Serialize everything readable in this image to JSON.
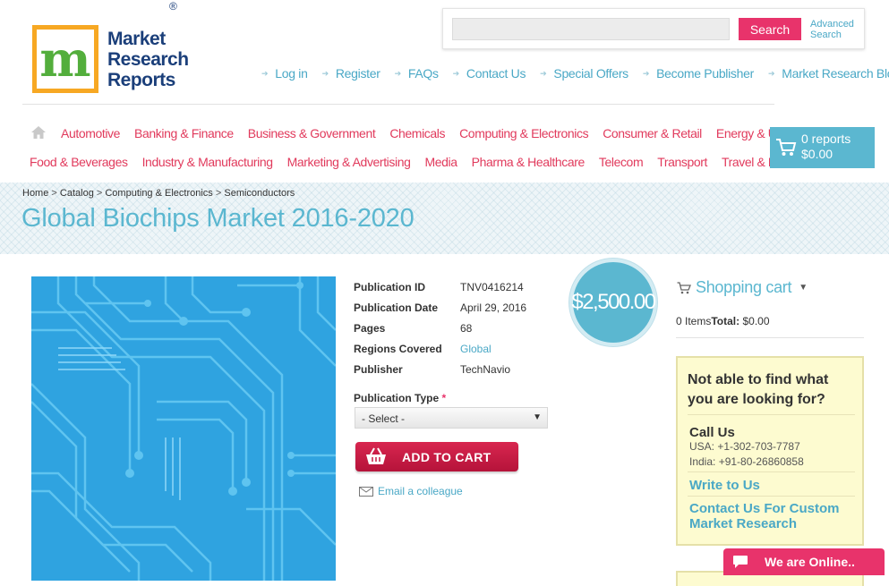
{
  "brand": {
    "logo_letter": "m",
    "name_lines": [
      "Market",
      "Research",
      "Reports"
    ],
    "registered": "®"
  },
  "search": {
    "placeholder": "",
    "button_label": "Search",
    "advanced_line1": "Advanced",
    "advanced_line2": "Search"
  },
  "top_links": [
    "Log in",
    "Register",
    "FAQs",
    "Contact Us",
    "Special Offers",
    "Become Publisher",
    "Market Research Blog"
  ],
  "categories_row1": [
    "Automotive",
    "Banking & Finance",
    "Business & Government",
    "Chemicals",
    "Computing & Electronics",
    "Consumer & Retail",
    "Energy & Utilities"
  ],
  "categories_row2": [
    "Food & Beverages",
    "Industry & Manufacturing",
    "Marketing & Advertising",
    "Media",
    "Pharma & Healthcare",
    "Telecom",
    "Transport",
    "Travel & Leisure"
  ],
  "cart_widget": {
    "count": "0 reports",
    "total": "$0.00"
  },
  "breadcrumb": [
    "Home",
    "Catalog",
    "Computing & Electronics",
    "Semiconductors"
  ],
  "breadcrumb_sep": " > ",
  "page_title": "Global Biochips Market 2016-2020",
  "details": [
    {
      "label": "Publication ID",
      "value": "TNV0416214"
    },
    {
      "label": "Publication Date",
      "value": "April 29, 2016"
    },
    {
      "label": "Pages",
      "value": "68"
    },
    {
      "label": "Regions Covered",
      "value": "Global"
    },
    {
      "label": "Publisher",
      "value": "TechNavio"
    }
  ],
  "price": "$2,500.00",
  "publication_type": {
    "label": "Publication Type",
    "required_mark": "*",
    "selected": "- Select -"
  },
  "add_to_cart_label": "ADD TO CART",
  "email_colleague_label": "Email a colleague",
  "shopping_cart": {
    "title": "Shopping cart",
    "items_text": "0 Items",
    "total_label": "Total:",
    "total_value": "$0.00"
  },
  "help": {
    "question": "Not able to find what you are looking for?",
    "call_title": "Call Us",
    "phone_usa": "USA: +1-302-703-7787",
    "phone_india": "India: +91-80-26860858",
    "write_link": "Write to Us",
    "custom_link": "Contact Us For Custom Market Research"
  },
  "chat": {
    "label": "We are Online.."
  },
  "colors": {
    "accent_pink": "#e8336b",
    "accent_blue": "#5bb7d0",
    "category_red": "#e13a5c",
    "help_bg": "#fdfbd0"
  },
  "icons": [
    "home-icon",
    "cart-icon",
    "shopping-cart-icon",
    "basket-icon",
    "envelope-icon",
    "chat-bubble-icon",
    "chevron-down-icon",
    "link-arrow-icon"
  ]
}
